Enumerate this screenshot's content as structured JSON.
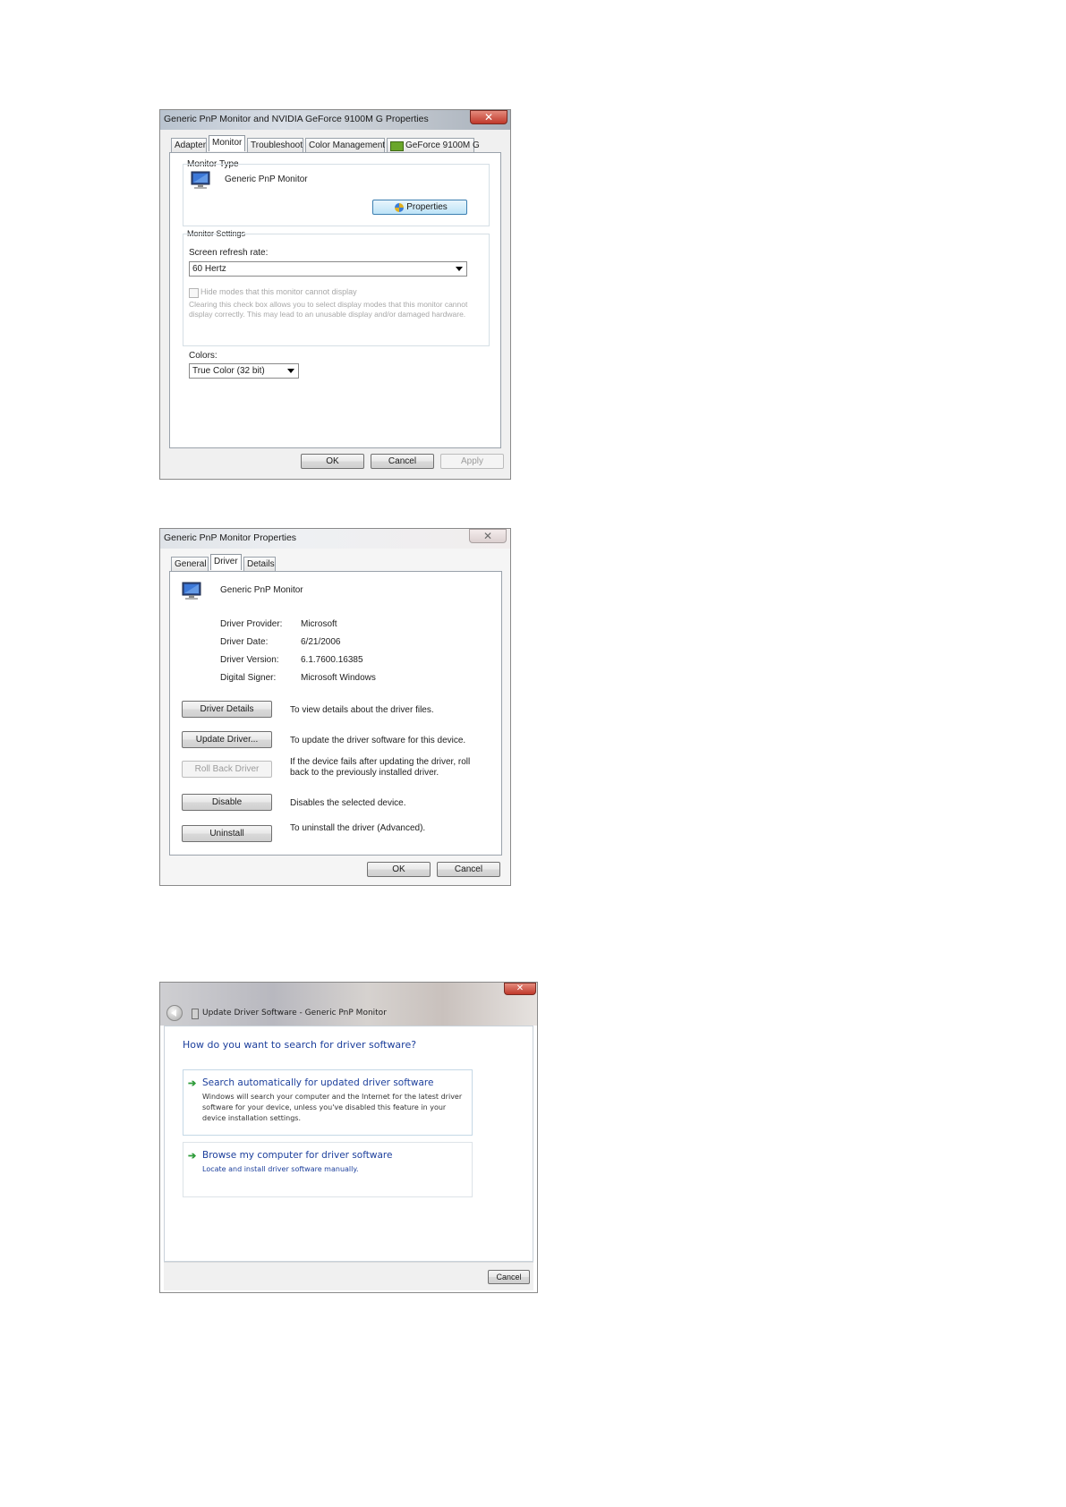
{
  "dialog1": {
    "title": "Generic PnP Monitor and NVIDIA GeForce 9100M G   Properties",
    "close_glyph": "✕",
    "tabs": [
      "Adapter",
      "Monitor",
      "Troubleshoot",
      "Color Management",
      "GeForce 9100M G"
    ],
    "active_tab": "Monitor",
    "monitor_type_label": "Monitor Type",
    "monitor_name": "Generic PnP Monitor",
    "properties_button": "Properties",
    "monitor_settings_label": "Monitor Settings",
    "refresh_rate_label": "Screen refresh rate:",
    "refresh_rate_value": "60 Hertz",
    "hide_modes_label": "Hide modes that this monitor cannot display",
    "hide_modes_checked": false,
    "hide_modes_desc": "Clearing this check box allows you to select display modes that this monitor cannot display correctly. This may lead to an unusable display and/or damaged hardware.",
    "colors_label": "Colors:",
    "colors_value": "True Color (32 bit)",
    "ok_button": "OK",
    "cancel_button": "Cancel",
    "apply_button": "Apply"
  },
  "dialog2": {
    "title": "Generic PnP Monitor Properties",
    "close_glyph": "✕",
    "tabs": [
      "General",
      "Driver",
      "Details"
    ],
    "active_tab": "Driver",
    "device_name": "Generic PnP Monitor",
    "info": [
      {
        "label": "Driver Provider:",
        "value": "Microsoft"
      },
      {
        "label": "Driver Date:",
        "value": "6/21/2006"
      },
      {
        "label": "Driver Version:",
        "value": "6.1.7600.16385"
      },
      {
        "label": "Digital Signer:",
        "value": "Microsoft Windows"
      }
    ],
    "actions": [
      {
        "button": "Driver Details",
        "desc": "To view details about the driver files.",
        "enabled": true
      },
      {
        "button": "Update Driver...",
        "desc": "To update the driver software for this device.",
        "enabled": true
      },
      {
        "button": "Roll Back Driver",
        "desc": "If the device fails after updating the driver, roll back to the previously installed driver.",
        "enabled": false
      },
      {
        "button": "Disable",
        "desc": "Disables the selected device.",
        "enabled": true
      },
      {
        "button": "Uninstall",
        "desc": "To uninstall the driver (Advanced).",
        "enabled": true
      }
    ],
    "ok_button": "OK",
    "cancel_button": "Cancel"
  },
  "dialog3": {
    "close_glyph": "✕",
    "breadcrumb": "Update Driver Software - Generic PnP Monitor",
    "heading": "How do you want to search for driver software?",
    "options": [
      {
        "title": "Search automatically for updated driver software",
        "desc": "Windows will search your computer and the Internet for the latest driver software for your device, unless you've disabled this feature in your device installation settings."
      },
      {
        "title": "Browse my computer for driver software",
        "desc": "Locate and install driver software manually."
      }
    ],
    "cancel_button": "Cancel"
  },
  "colors": {
    "close_red": "#c0392b",
    "link_blue": "#1c3f9c",
    "arrow_green": "#2e9c3a"
  }
}
